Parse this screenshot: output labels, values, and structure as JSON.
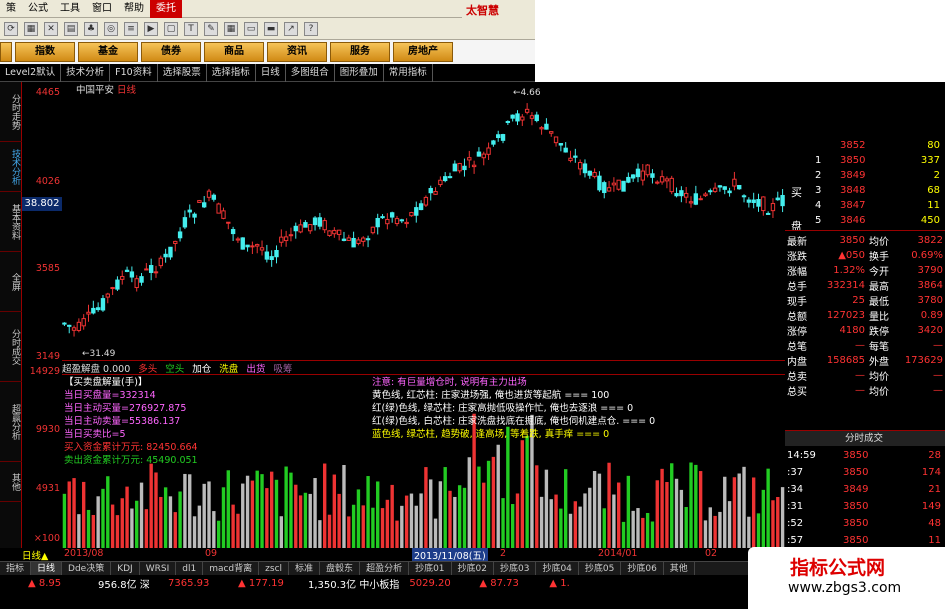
{
  "menu": {
    "items": [
      "策",
      "公式",
      "工具",
      "窗口",
      "帮助",
      "委托"
    ],
    "brand": "太智慧"
  },
  "nav": {
    "buttons": [
      "",
      "指数",
      "基金",
      "债券",
      "商品",
      "资讯",
      "服务",
      "房地产"
    ]
  },
  "subtabs": [
    "Level2默认",
    "技术分析",
    "F10资料",
    "选择股票",
    "选择指标",
    "日线",
    "多图组合",
    "图形叠加",
    "常用指标"
  ],
  "sidebar": [
    "分时走势",
    "技术分析",
    "基本资料",
    "全屏",
    "分时成交",
    "超赢分析",
    "其他"
  ],
  "chart": {
    "title": "中国平安",
    "period": "日线",
    "price_tag": "38.802",
    "y_ticks": [
      "4465",
      "4026",
      "3585",
      "3149"
    ],
    "high_label": "4.66",
    "low_label": "31.49",
    "vol_ticks": [
      "14929",
      "9930",
      "4931",
      "×100"
    ]
  },
  "indicator_bar": {
    "name": "超盈解盘",
    "value": "0.000",
    "many": "多头",
    "empty": "空头",
    "add": "加仓",
    "wash": "洗盘",
    "out": "出货",
    "extra": "吸筹"
  },
  "legend": {
    "title": "【买卖盘解量(手)】",
    "lines": [
      {
        "text": "当日买盘量=332314",
        "color": "#f6f"
      },
      {
        "text": "当日主动买量=276927.875",
        "color": "#f6f"
      },
      {
        "text": "当日主动卖量=55386.137",
        "color": "#f6f"
      },
      {
        "text": "当日买卖比=5",
        "color": "#f6f"
      },
      {
        "text": "买入资金累计万元: 82450.664",
        "color": "#f33"
      },
      {
        "text": "卖出资金累计万元: 45490.051",
        "color": "#2c2"
      }
    ]
  },
  "notes": {
    "title": "注意: 有巨量增仓时, 说明有主力出场",
    "lines": [
      "黄色线, 红芯柱: 庄家进场强, 俺也进货等起航 === 100",
      "红(绿)色线, 绿芯柱: 庄家高抛低吸操作忙, 俺也去逐浪 === 0",
      "红(绿)色线, 白芯柱: 庄家洗盘找底在掘底, 俺也伺机建点仓. === 0",
      "蓝色线, 绿芯柱, 趋势破, 逢高场, 等着跌, 真手痒 === 0"
    ]
  },
  "datebar": {
    "labels": [
      "2013/08",
      "09",
      "2013/11/08(五)",
      "2",
      "2014/01",
      "02"
    ]
  },
  "bottom_tabs": [
    "指标",
    "日线",
    "Dde决策",
    "KDJ",
    "WRSI",
    "dl1",
    "macd背离",
    "zscl",
    "标准",
    "盘毂东",
    "超盈分析",
    "抄底01",
    "抄底02",
    "抄底03",
    "抄底04",
    "抄底05",
    "抄底06",
    "其他"
  ],
  "ticker": {
    "items": [
      {
        "text": "▲ 8.95",
        "color": "#f33"
      },
      {
        "text": "956.8亿 深",
        "color": "#fff"
      },
      {
        "text": "7365.93",
        "color": "#f33"
      },
      {
        "text": "▲ 177.19",
        "color": "#f33"
      },
      {
        "text": "1,350.3亿 中小板指",
        "color": "#fff"
      },
      {
        "text": "5029.20",
        "color": "#f33"
      },
      {
        "text": "▲ 87.73",
        "color": "#f33"
      },
      {
        "text": "▲ 1.",
        "color": "#f33"
      }
    ]
  },
  "quote": {
    "asks": [
      {
        "lvl": "",
        "price": "3852",
        "vol": "80"
      },
      {
        "lvl": "1",
        "price": "3850",
        "vol": "337"
      },
      {
        "lvl": "2",
        "price": "3849",
        "vol": "2"
      },
      {
        "lvl": "3",
        "price": "3848",
        "vol": "68"
      },
      {
        "lvl": "4",
        "price": "3847",
        "vol": "11"
      },
      {
        "lvl": "5",
        "price": "3846",
        "vol": "450"
      }
    ],
    "side_buy": "买",
    "side_sell": "盘",
    "rows": [
      {
        "l": "最新",
        "v1": "3850",
        "l2": "均价",
        "v2": "3822"
      },
      {
        "l": "涨跌",
        "v1": "▲050",
        "l2": "换手",
        "v2": "0.69%"
      },
      {
        "l": "涨幅",
        "v1": "1.32%",
        "l2": "今开",
        "v2": "3790"
      },
      {
        "l": "总手",
        "v1": "332314",
        "l2": "最高",
        "v2": "3864"
      },
      {
        "l": "现手",
        "v1": "25",
        "l2": "最低",
        "v2": "3780"
      },
      {
        "l": "总额",
        "v1": "127023",
        "l2": "量比",
        "v2": "0.89"
      },
      {
        "l": "涨停",
        "v1": "4180",
        "l2": "跌停",
        "v2": "3420"
      },
      {
        "l": "总笔",
        "v1": "—",
        "l2": "每笔",
        "v2": "—"
      },
      {
        "l": "内盘",
        "v1": "158685",
        "l2": "外盘",
        "v2": "173629"
      },
      {
        "l": "总卖",
        "v1": "—",
        "l2": "均价",
        "v2": "—"
      },
      {
        "l": "总买",
        "v1": "—",
        "l2": "均价",
        "v2": "—"
      }
    ],
    "trades_title": "分时成交",
    "trades": [
      {
        "t": "14:59",
        "p": "3850",
        "v": "28"
      },
      {
        "t": ":37",
        "p": "3850",
        "v": "174"
      },
      {
        "t": ":34",
        "p": "3849",
        "v": "21"
      },
      {
        "t": ":31",
        "p": "3850",
        "v": "149"
      },
      {
        "t": ":52",
        "p": "3850",
        "v": "48"
      },
      {
        "t": ":57",
        "p": "3850",
        "v": "11"
      }
    ]
  },
  "watermark": {
    "title": "指标公式网",
    "url": "www.zbgs3.com"
  }
}
